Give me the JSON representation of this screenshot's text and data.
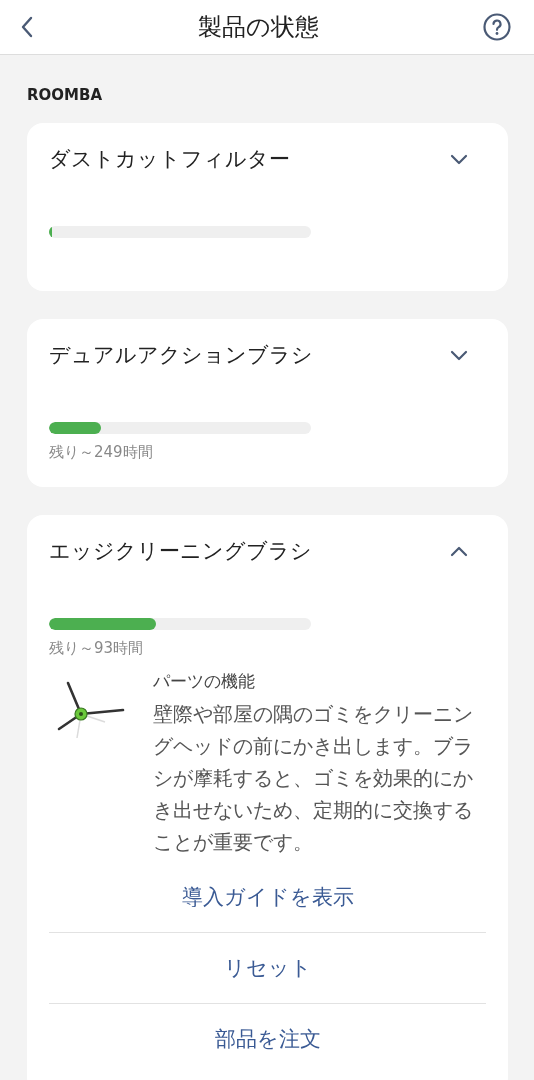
{
  "header": {
    "title": "製品の状態"
  },
  "section_label": "ROOMBA",
  "parts": [
    {
      "name": "ダストカットフィルター",
      "expanded": false,
      "level": 0.01
    },
    {
      "name": "デュアルアクションブラシ",
      "expanded": false,
      "level": 0.2,
      "remaining": "残り～249時間"
    },
    {
      "name": "エッジクリーニングブラシ",
      "expanded": true,
      "level": 0.41,
      "remaining": "残り～93時間",
      "detail": {
        "heading": "パーツの機能",
        "description": "壁際や部屋の隅のゴミをクリーニングヘッドの前にかき出します。ブラシが摩耗すると、ゴミを効果的にかき出せないため、定期的に交換することが重要です。",
        "actions": [
          "導入ガイドを表示",
          "リセット",
          "部品を注文"
        ]
      }
    }
  ]
}
